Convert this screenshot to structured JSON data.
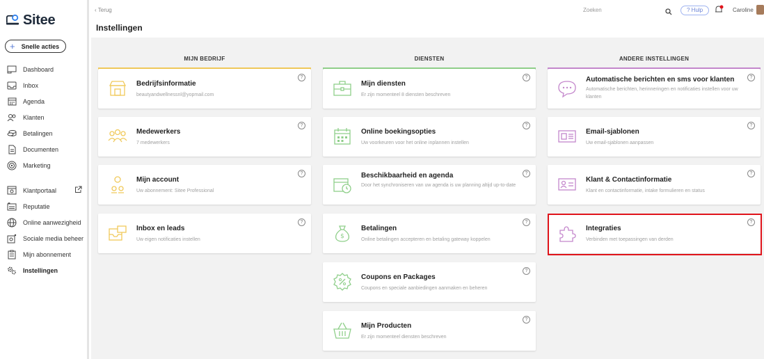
{
  "app": {
    "logo_text": "Sitee"
  },
  "sidebar": {
    "quick_actions": "Snelle acties",
    "items": [
      {
        "label": "Dashboard",
        "icon": "dashboard-icon"
      },
      {
        "label": "Inbox",
        "icon": "inbox-icon"
      },
      {
        "label": "Agenda",
        "icon": "calendar-icon"
      },
      {
        "label": "Klanten",
        "icon": "users-icon"
      },
      {
        "label": "Betalingen",
        "icon": "payments-icon"
      },
      {
        "label": "Documenten",
        "icon": "document-icon"
      },
      {
        "label": "Marketing",
        "icon": "target-icon"
      }
    ],
    "items2": [
      {
        "label": "Klantportaal",
        "icon": "portal-icon"
      },
      {
        "label": "Reputatie",
        "icon": "reputation-icon"
      },
      {
        "label": "Online aanwezigheid",
        "icon": "globe-icon"
      },
      {
        "label": "Sociale media beheer",
        "icon": "social-icon"
      },
      {
        "label": "Mijn abonnement",
        "icon": "subscription-icon"
      },
      {
        "label": "Instellingen",
        "icon": "settings-icon",
        "active": true
      }
    ]
  },
  "topbar": {
    "back": "‹ Terug",
    "title": "Instellingen",
    "search_placeholder": "Zoeken",
    "help": "? Hulp",
    "user": "Caroline"
  },
  "columns": [
    {
      "header": "MIJN BEDRIJF",
      "color": "#f0c95a"
    },
    {
      "header": "DIENSTEN",
      "color": "#8fcf8a"
    },
    {
      "header": "ANDERE INSTELLINGEN",
      "color": "#c487cc"
    }
  ],
  "cards": {
    "col1": [
      {
        "title": "Bedrijfsinformatie",
        "sub": "beautyandwellnessnl@yopmail.com"
      },
      {
        "title": "Medewerkers",
        "sub": "7 medewerkers"
      },
      {
        "title": "Mijn account",
        "sub": "Uw abonnement: Sitee Professional"
      },
      {
        "title": "Inbox en leads",
        "sub": "Uw eigen notificaties instellen"
      }
    ],
    "col2": [
      {
        "title": "Mijn diensten",
        "sub": "Er zijn momenteel 8 diensten beschreven"
      },
      {
        "title": "Online boekingsopties",
        "sub": "Uw voorkeuren voor het online inplannen instellen"
      },
      {
        "title": "Beschikbaarheid en agenda",
        "sub": "Door het synchroniseren van uw agenda is uw planning altijd up-to-date"
      },
      {
        "title": "Betalingen",
        "sub": "Online betalingen accepteren en betaling gateway koppelen"
      },
      {
        "title": "Coupons en Packages",
        "sub": "Coupons en speciale aanbiedingen aanmaken en beheren"
      },
      {
        "title": "Mijn Producten",
        "sub": "Er zijn momenteel diensten beschreven"
      }
    ],
    "col3": [
      {
        "title": "Automatische berichten en sms voor klanten",
        "sub": "Automatische berichten, herinneringen en notificaties instellen voor uw klanten"
      },
      {
        "title": "Email-sjablonen",
        "sub": "Uw email-sjablonen aanpassen"
      },
      {
        "title": "Klant & Contactinformatie",
        "sub": "Klant en contactinformatie, intake formulieren en status"
      },
      {
        "title": "Integraties",
        "sub": "Verbinden met toepassingen van derden"
      }
    ]
  },
  "help_glyph": "?"
}
